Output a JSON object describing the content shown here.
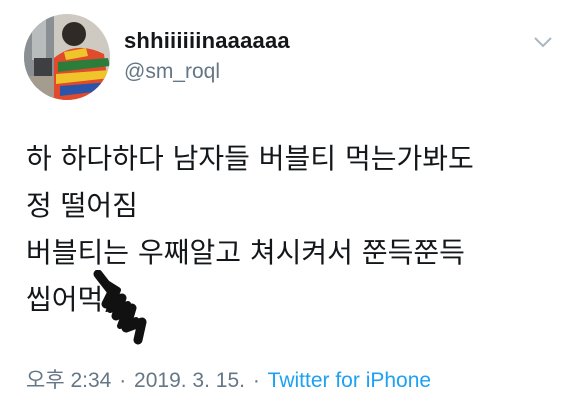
{
  "user": {
    "display_name": "shhiiiiiinaaaaaa",
    "handle": "@sm_roql"
  },
  "tweet": {
    "lines": [
      "하 하다하다 남자들 버블티 먹는가봐도",
      "정 떨어짐",
      "버블티는 우째알고 쳐시켜서 쭌득쭌득",
      "씹어먹;;"
    ],
    "time": "오후 2:34",
    "separator": "·",
    "date": "2019. 3. 15.",
    "source": "Twitter for iPhone"
  },
  "icons": {
    "caret": "chevron-down-icon",
    "avatar": "avatar-photo",
    "scribble": "scribble-marker"
  },
  "colors": {
    "name": "#14171a",
    "secondary": "#657786",
    "link": "#1da1f2",
    "caret": "#aab8c2"
  }
}
